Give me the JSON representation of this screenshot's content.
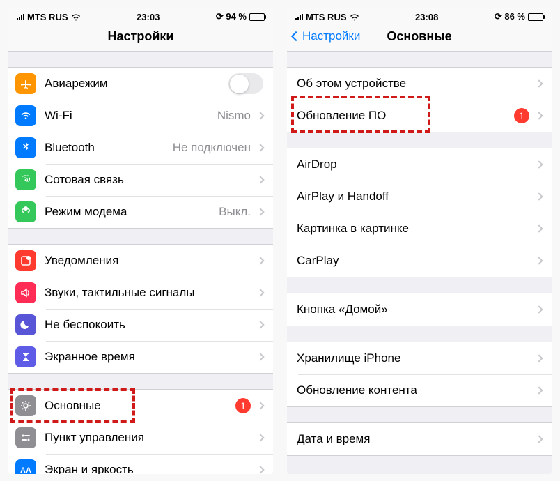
{
  "leftPhone": {
    "status": {
      "carrier": "MTS RUS",
      "time": "23:03",
      "battery_pct": "94 %",
      "battery_fill": 94
    },
    "title": "Настройки",
    "group1": [
      {
        "id": "airplane",
        "label": "Авиарежим",
        "accessory": "switch",
        "iconBg": "bg-orange"
      },
      {
        "id": "wifi",
        "label": "Wi-Fi",
        "value": "Nismo",
        "iconBg": "bg-blue"
      },
      {
        "id": "bluetooth",
        "label": "Bluetooth",
        "value": "Не подключен",
        "iconBg": "bg-blue"
      },
      {
        "id": "cellular",
        "label": "Сотовая связь",
        "iconBg": "bg-green"
      },
      {
        "id": "hotspot",
        "label": "Режим модема",
        "value": "Выкл.",
        "iconBg": "bg-green2"
      }
    ],
    "group2": [
      {
        "id": "notifications",
        "label": "Уведомления",
        "iconBg": "bg-red"
      },
      {
        "id": "sounds",
        "label": "Звуки, тактильные сигналы",
        "iconBg": "bg-pink"
      },
      {
        "id": "dnd",
        "label": "Не беспокоить",
        "iconBg": "bg-purple"
      },
      {
        "id": "screentime",
        "label": "Экранное время",
        "iconBg": "bg-purple2"
      }
    ],
    "group3": [
      {
        "id": "general",
        "label": "Основные",
        "badge": "1",
        "iconBg": "bg-gray",
        "highlight": true
      },
      {
        "id": "control-center",
        "label": "Пункт управления",
        "iconBg": "bg-gray"
      },
      {
        "id": "display",
        "label": "Экран и яркость",
        "iconBg": "bg-bluetxt"
      }
    ]
  },
  "rightPhone": {
    "status": {
      "carrier": "MTS RUS",
      "time": "23:08",
      "battery_pct": "86 %",
      "battery_fill": 86
    },
    "back": "Настройки",
    "title": "Основные",
    "group1": [
      {
        "id": "about",
        "label": "Об этом устройстве"
      },
      {
        "id": "software-update",
        "label": "Обновление ПО",
        "badge": "1",
        "highlight": true
      }
    ],
    "group2": [
      {
        "id": "airdrop",
        "label": "AirDrop"
      },
      {
        "id": "airplay",
        "label": "AirPlay и Handoff"
      },
      {
        "id": "pip",
        "label": "Картинка в картинке"
      },
      {
        "id": "carplay",
        "label": "CarPlay"
      }
    ],
    "group3": [
      {
        "id": "homebutton",
        "label": "Кнопка «Домой»"
      }
    ],
    "group4": [
      {
        "id": "storage",
        "label": "Хранилище iPhone"
      },
      {
        "id": "content-refresh",
        "label": "Обновление контента"
      }
    ],
    "group5": [
      {
        "id": "date-time",
        "label": "Дата и время"
      }
    ]
  }
}
